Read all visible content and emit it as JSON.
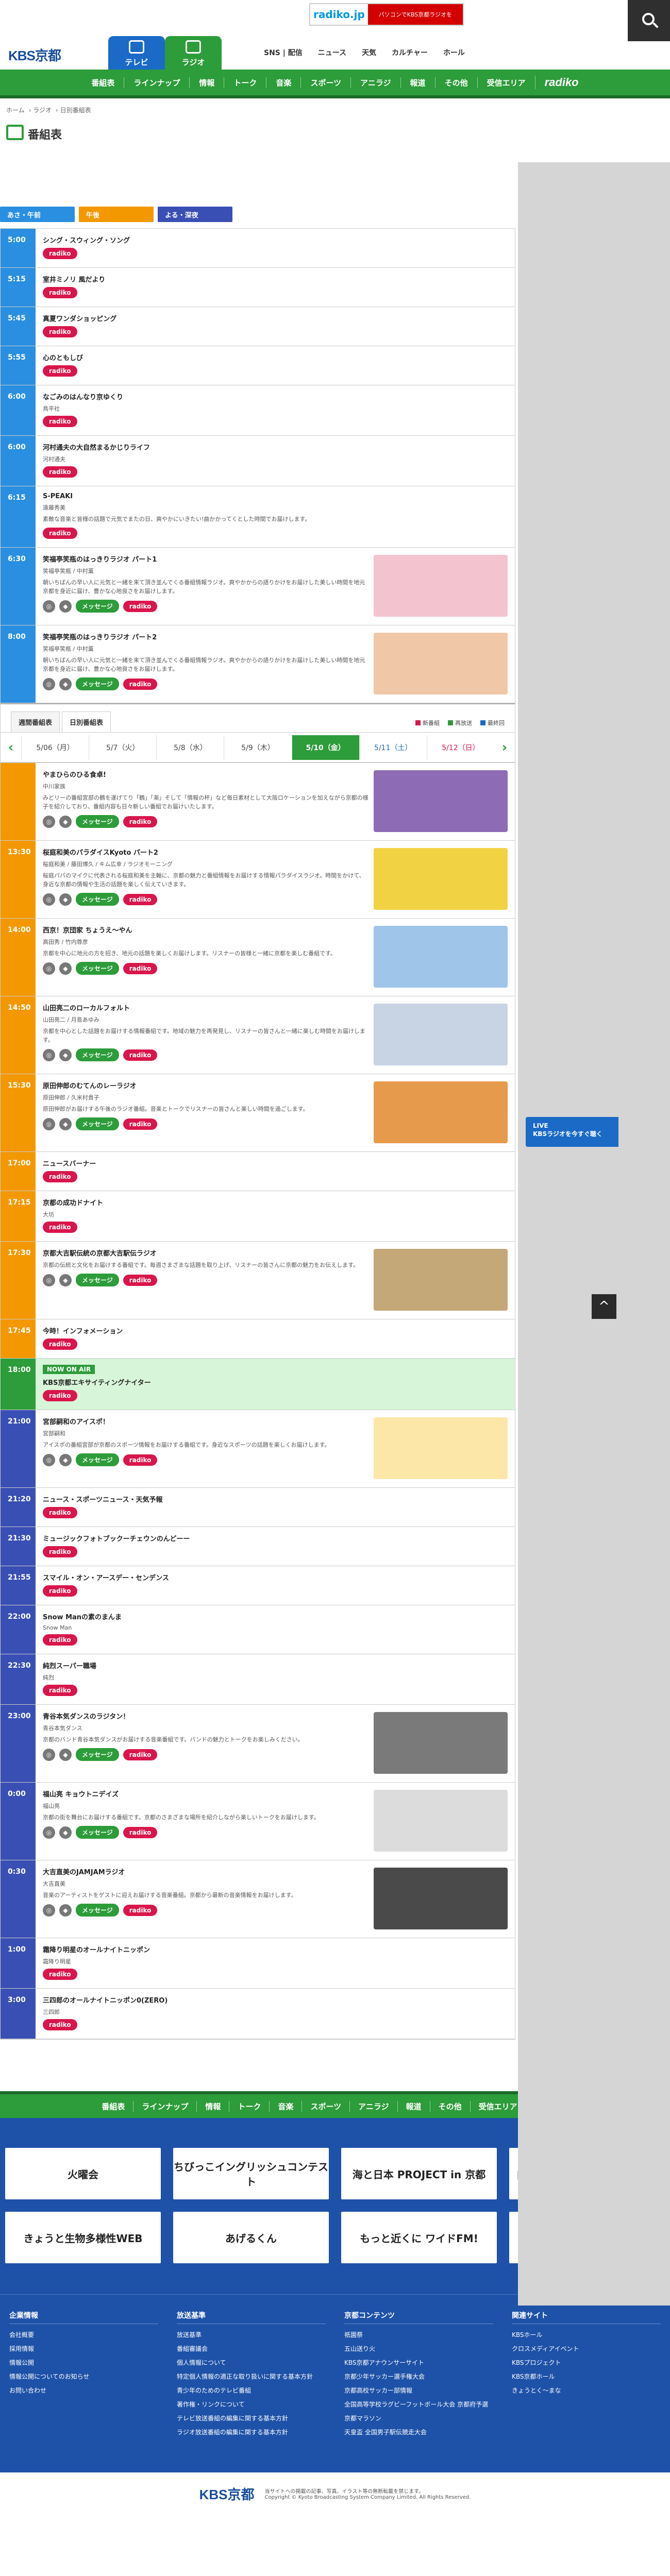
{
  "header": {
    "logo": "KBS京都",
    "tab_tv": "テレビ",
    "tab_radio": "ラジオ",
    "nav": [
      "SNS | 配信",
      "ニュース",
      "天気",
      "カルチャー",
      "ホール"
    ],
    "radiko_logo": "radiko.jp",
    "radiko_text": "パソコンでKBS京都ラジオを"
  },
  "greennav": [
    "番組表",
    "ラインナップ",
    "情報",
    "トーク",
    "音楽",
    "スポーツ",
    "アニラジ",
    "報道",
    "その他",
    "受信エリア",
    "radiko"
  ],
  "breadcrumb": [
    "ホーム",
    "ラジオ",
    "日別番組表"
  ],
  "page_title": "番組表",
  "tod": {
    "morning": "あさ・午前",
    "noon": "午後",
    "night": "よる・深夜"
  },
  "buttons": {
    "radiko": "radiko",
    "message": "メッセージ"
  },
  "programs": [
    {
      "time": "5:00",
      "band": "m",
      "title": "シング・スウィング・ソング",
      "sub": "",
      "desc": ""
    },
    {
      "time": "5:15",
      "band": "m",
      "title": "室井ミノリ 風だより",
      "sub": "",
      "desc": ""
    },
    {
      "time": "5:45",
      "band": "m",
      "title": "真夏ワンダショッピング",
      "sub": "",
      "desc": ""
    },
    {
      "time": "5:55",
      "band": "m",
      "title": "心のともしび",
      "sub": "",
      "desc": ""
    },
    {
      "time": "6:00",
      "band": "m",
      "title": "なごみのはんなり京ゆくり",
      "sub": "鳥平社",
      "desc": ""
    },
    {
      "time": "6:00",
      "band": "m",
      "title": "河村通夫の大自然まるかじりライフ",
      "sub": "河村通夫",
      "desc": ""
    },
    {
      "time": "6:15",
      "band": "m",
      "title": "S-PEAKI",
      "sub": "遠藤秀美",
      "desc": "素敵な音楽と皆様の話題で元気でまたの日、爽やかにいきたい!曲かかってくとした時間でお届けします。"
    },
    {
      "time": "6:30",
      "band": "m",
      "title": "笑福亭笑瓶のはっきりラジオ パート1",
      "sub": "笑福亭笑瓶 / 中村薫",
      "desc": "朝いちばんの早い人に元気と一緒を来て頂き並んでくる番組情報ラジオ。爽やかからの語りかけをお届けした美しい時間を地元京都を身近に届け、豊かな心地良さをお届けします。",
      "img": "#f4c3d0"
    },
    {
      "time": "8:00",
      "band": "m",
      "title": "笑福亭笑瓶のはっきりラジオ パート2",
      "sub": "笑福亭笑瓶 / 中村薫",
      "desc": "朝いちばんの早い人に元気と一緒を来て頂き並んでくる番組情報ラジオ。爽やかからの語りかけをお届けした美しい時間を地元京都を身近に届け、豊かな心地良さをお届けします。",
      "img": "#f1c8a7"
    }
  ],
  "daybar": {
    "views": [
      "週間番組表",
      "日別番組表"
    ],
    "legend": [
      {
        "label": "新番組",
        "color": "#d9164b"
      },
      {
        "label": "再放送",
        "color": "#2d9c3a"
      },
      {
        "label": "最終回",
        "color": "#1a6ac6"
      }
    ],
    "days": [
      "5/06（月）",
      "5/7（火）",
      "5/8（水）",
      "5/9（木）",
      "5/10（金）",
      "5/11（土）",
      "5/12（日）"
    ],
    "selected": 4
  },
  "programs2": [
    {
      "time": "",
      "band": "n",
      "title": "やまひらのひる食卓!",
      "sub": "中川家族",
      "desc": "みどリーの番組宮部の鶴を遂げてり「鶴」「漸」そして「情報の杯」など毎日素材として大阪ロケーションを加えながら京都の様子を紹介しており、番組内容も日々新しい番組でお届けいたします。",
      "img": "#8d6bb5"
    },
    {
      "time": "13:30",
      "band": "n",
      "title": "桜庭和美のパラダイスKyoto パート2",
      "sub": "桜庭和美 / 藤田博久 / キム広幸 / ラジオモーニング",
      "desc": "桜庭パパのマイクに代表される桜庭和美を主軸に、京都の魅力と番組情報をお届けする情報パラダイスラジオ。時間をかけて、身近な京都の情報や生活の話題を楽しく伝えていきます。",
      "img": "#f1d243"
    },
    {
      "time": "14:00",
      "band": "n",
      "title": "西京！京団家 ちょうえ〜やん",
      "sub": "高田秀 / 竹内尊彦",
      "desc": "京都を中心に地元の方を招き、地元の話題を楽しくお届けします。リスナーの皆様と一緒に京都を楽しむ番組です。",
      "img": "#9fc5e8"
    },
    {
      "time": "14:50",
      "band": "n",
      "title": "山田亮二のローカルフォルト",
      "sub": "山田亮二 / 月島あゆみ",
      "desc": "京都を中心とした話題をお届けする情報番組です。地域の魅力を再発見し、リスナーの皆さんと一緒に楽しむ時間をお届けします。",
      "img": "#c8d4e3"
    },
    {
      "time": "15:30",
      "band": "n",
      "title": "原田伸郎のむてんのレーラジオ",
      "sub": "原田伸郎 / 久米村貴子",
      "desc": "原田伸郎がお届けする午後のラジオ番組。音楽とトークでリスナーの皆さんと楽しい時間を過ごします。",
      "img": "#e69a4b"
    },
    {
      "time": "17:00",
      "band": "n",
      "title": "ニュースバーナー",
      "sub": "",
      "desc": ""
    },
    {
      "time": "17:15",
      "band": "n",
      "title": "京都の成功ドナイト",
      "sub": "大坊",
      "desc": ""
    },
    {
      "time": "17:30",
      "band": "n",
      "title": "京都大吉駅伝統の京都大吉駅伝ラジオ",
      "sub": "",
      "desc": "京都の伝統と文化をお届けする番組です。毎週さまざまな話題を取り上げ、リスナーの皆さんに京都の魅力をお伝えします。",
      "img": "#c5a878"
    },
    {
      "time": "17:45",
      "band": "n",
      "title": "今時！インフォメーション",
      "sub": "",
      "desc": ""
    },
    {
      "time": "18:00",
      "band": "g",
      "title": "KBS京都エキサイティングナイター",
      "sub": "",
      "desc": "",
      "onair": "NOW ON AIR"
    },
    {
      "time": "21:00",
      "band": "e",
      "title": "宮部嗣和のアイスポ！",
      "sub": "宮部嗣和",
      "desc": "アイスポの番組宮部が京都のスポーツ情報をお届けする番組です。身近なスポーツの話題を楽しくお届けします。",
      "img": "#fde7a8"
    },
    {
      "time": "21:20",
      "band": "e",
      "title": "ニュース・スポーツニュース・天気予報",
      "sub": "",
      "desc": ""
    },
    {
      "time": "21:30",
      "band": "e",
      "title": "ミュージックフォトブックーチェウンのんどーー",
      "sub": "",
      "desc": ""
    },
    {
      "time": "21:55",
      "band": "e",
      "title": "スマイル・オン・アースデー・センデンス",
      "sub": "",
      "desc": ""
    },
    {
      "time": "22:00",
      "band": "e",
      "title": "Snow Manの素のまんま",
      "sub": "Snow Man",
      "desc": ""
    },
    {
      "time": "22:30",
      "band": "e",
      "title": "純烈スーパー職場",
      "sub": "純烈",
      "desc": ""
    },
    {
      "time": "23:00",
      "band": "e",
      "title": "青谷本気ダンスのラジタン！",
      "sub": "青谷本気ダンス",
      "desc": "京都のバンド青谷本気ダンスがお届けする音楽番組です。バンドの魅力とトークをお楽しみください。",
      "img": "#7a7a7a"
    },
    {
      "time": "0:00",
      "band": "e",
      "title": "福山亮 キョウトニデイズ",
      "sub": "福山亮",
      "desc": "京都の街を舞台にお届けする番組です。京都のさまざまな場所を紹介しながら楽しいトークをお届けします。",
      "img": "#dcdcdc"
    },
    {
      "time": "0:30",
      "band": "e",
      "title": "大吉直美のJAMJAMラジオ",
      "sub": "大吉直美",
      "desc": "音楽のアーティストをゲストに迎えお届けする音楽番組。京都から最新の音楽情報をお届けします。",
      "img": "#4a4a4a"
    },
    {
      "time": "1:00",
      "band": "e",
      "title": "霜降り明星のオールナイトニッポン",
      "sub": "霜降り明星",
      "desc": ""
    },
    {
      "time": "3:00",
      "band": "e",
      "title": "三四郎のオールナイトニッポン0(ZERO)",
      "sub": "三四郎",
      "desc": ""
    }
  ],
  "live": {
    "line1": "LIVE",
    "line2": "KBSラジオを今すぐ聴く"
  },
  "banners": [
    "火曜会",
    "ちびっこイングリッシュコンテスト",
    "海と日本 PROJECT in 京都",
    "自転車交通安全CMコンテスト",
    "きょうと生物多様性WEB",
    "あげるくん",
    "もっと近くに ワイドFM!",
    ""
  ],
  "footer": {
    "cols": [
      {
        "title": "企業情報",
        "items": [
          "会社概要",
          "採用情報",
          "情報公開",
          "情報公開についてのお知らせ",
          "お問い合わせ"
        ]
      },
      {
        "title": "放送基準",
        "items": [
          "放送基準",
          "番組審議会",
          "個人情報について",
          "特定個人情報の適正な取り扱いに関する基本方針",
          "青少年のためのテレビ番組",
          "著作権・リンクについて",
          "テレビ放送番組の編集に関する基本方針",
          "ラジオ放送番組の編集に関する基本方針"
        ]
      },
      {
        "title": "京都コンテンツ",
        "items": [
          "祇園祭",
          "五山送り火",
          "KBS京都アナウンサーサイト",
          "京都少年サッカー選手権大会",
          "京都高校サッカー部情報",
          "全国高等学校ラグビーフットボール大会 京都府予選",
          "京都マラソン",
          "天皇盃 全国男子駅伝競走大会"
        ]
      },
      {
        "title": "関連サイト",
        "items": [
          "KBSホール",
          "クロスメディアイベント",
          "KBSプロジェクト",
          "KBS京都ホール",
          "きょうとく～まな"
        ]
      }
    ],
    "copyright": "当サイトへの掲載の記事、写真、イラスト等の無断転載を禁じます。",
    "copyright2": "Copyright © Kyoto Broadcasting System Company Limited. All Rights Reserved.",
    "logo": "KBS京都"
  }
}
